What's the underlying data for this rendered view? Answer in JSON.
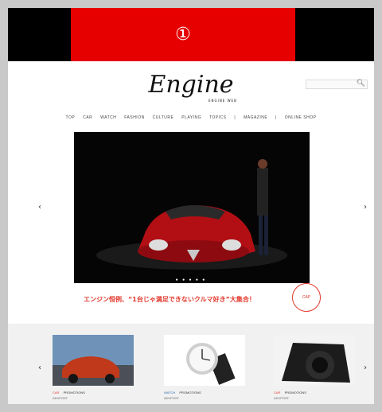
{
  "banner": {
    "label": "①",
    "accent": "#e60000"
  },
  "header": {
    "logo": "Engine",
    "logo_sub": "ENGINE WEB",
    "search_placeholder": "",
    "search_icon": "search-icon"
  },
  "nav": {
    "items": [
      "TOP",
      "CAR",
      "WATCH",
      "FASHION",
      "CULTURE",
      "PLAYING",
      "TOPICS",
      "|",
      "MAGAZINE",
      "|",
      "ONLINE SHOP"
    ]
  },
  "hero": {
    "caption": "エンジン恒例、“1台じゃ満足できないクルマ好き”大集合！",
    "dots": "● ● ● ● ●",
    "badge": "CAP",
    "prev": "‹",
    "next": "›"
  },
  "cards": [
    {
      "category": "CAR",
      "tag": "PROMOTIONS",
      "line2": "ADVPOST"
    },
    {
      "category": "WATCH",
      "tag": "PROMOTIONS",
      "line2": "ADVPOST"
    },
    {
      "category": "CAR",
      "tag": "PROMOTIONS",
      "line2": "ADVPOST"
    }
  ],
  "carousel": {
    "prev": "‹",
    "next": "›"
  }
}
